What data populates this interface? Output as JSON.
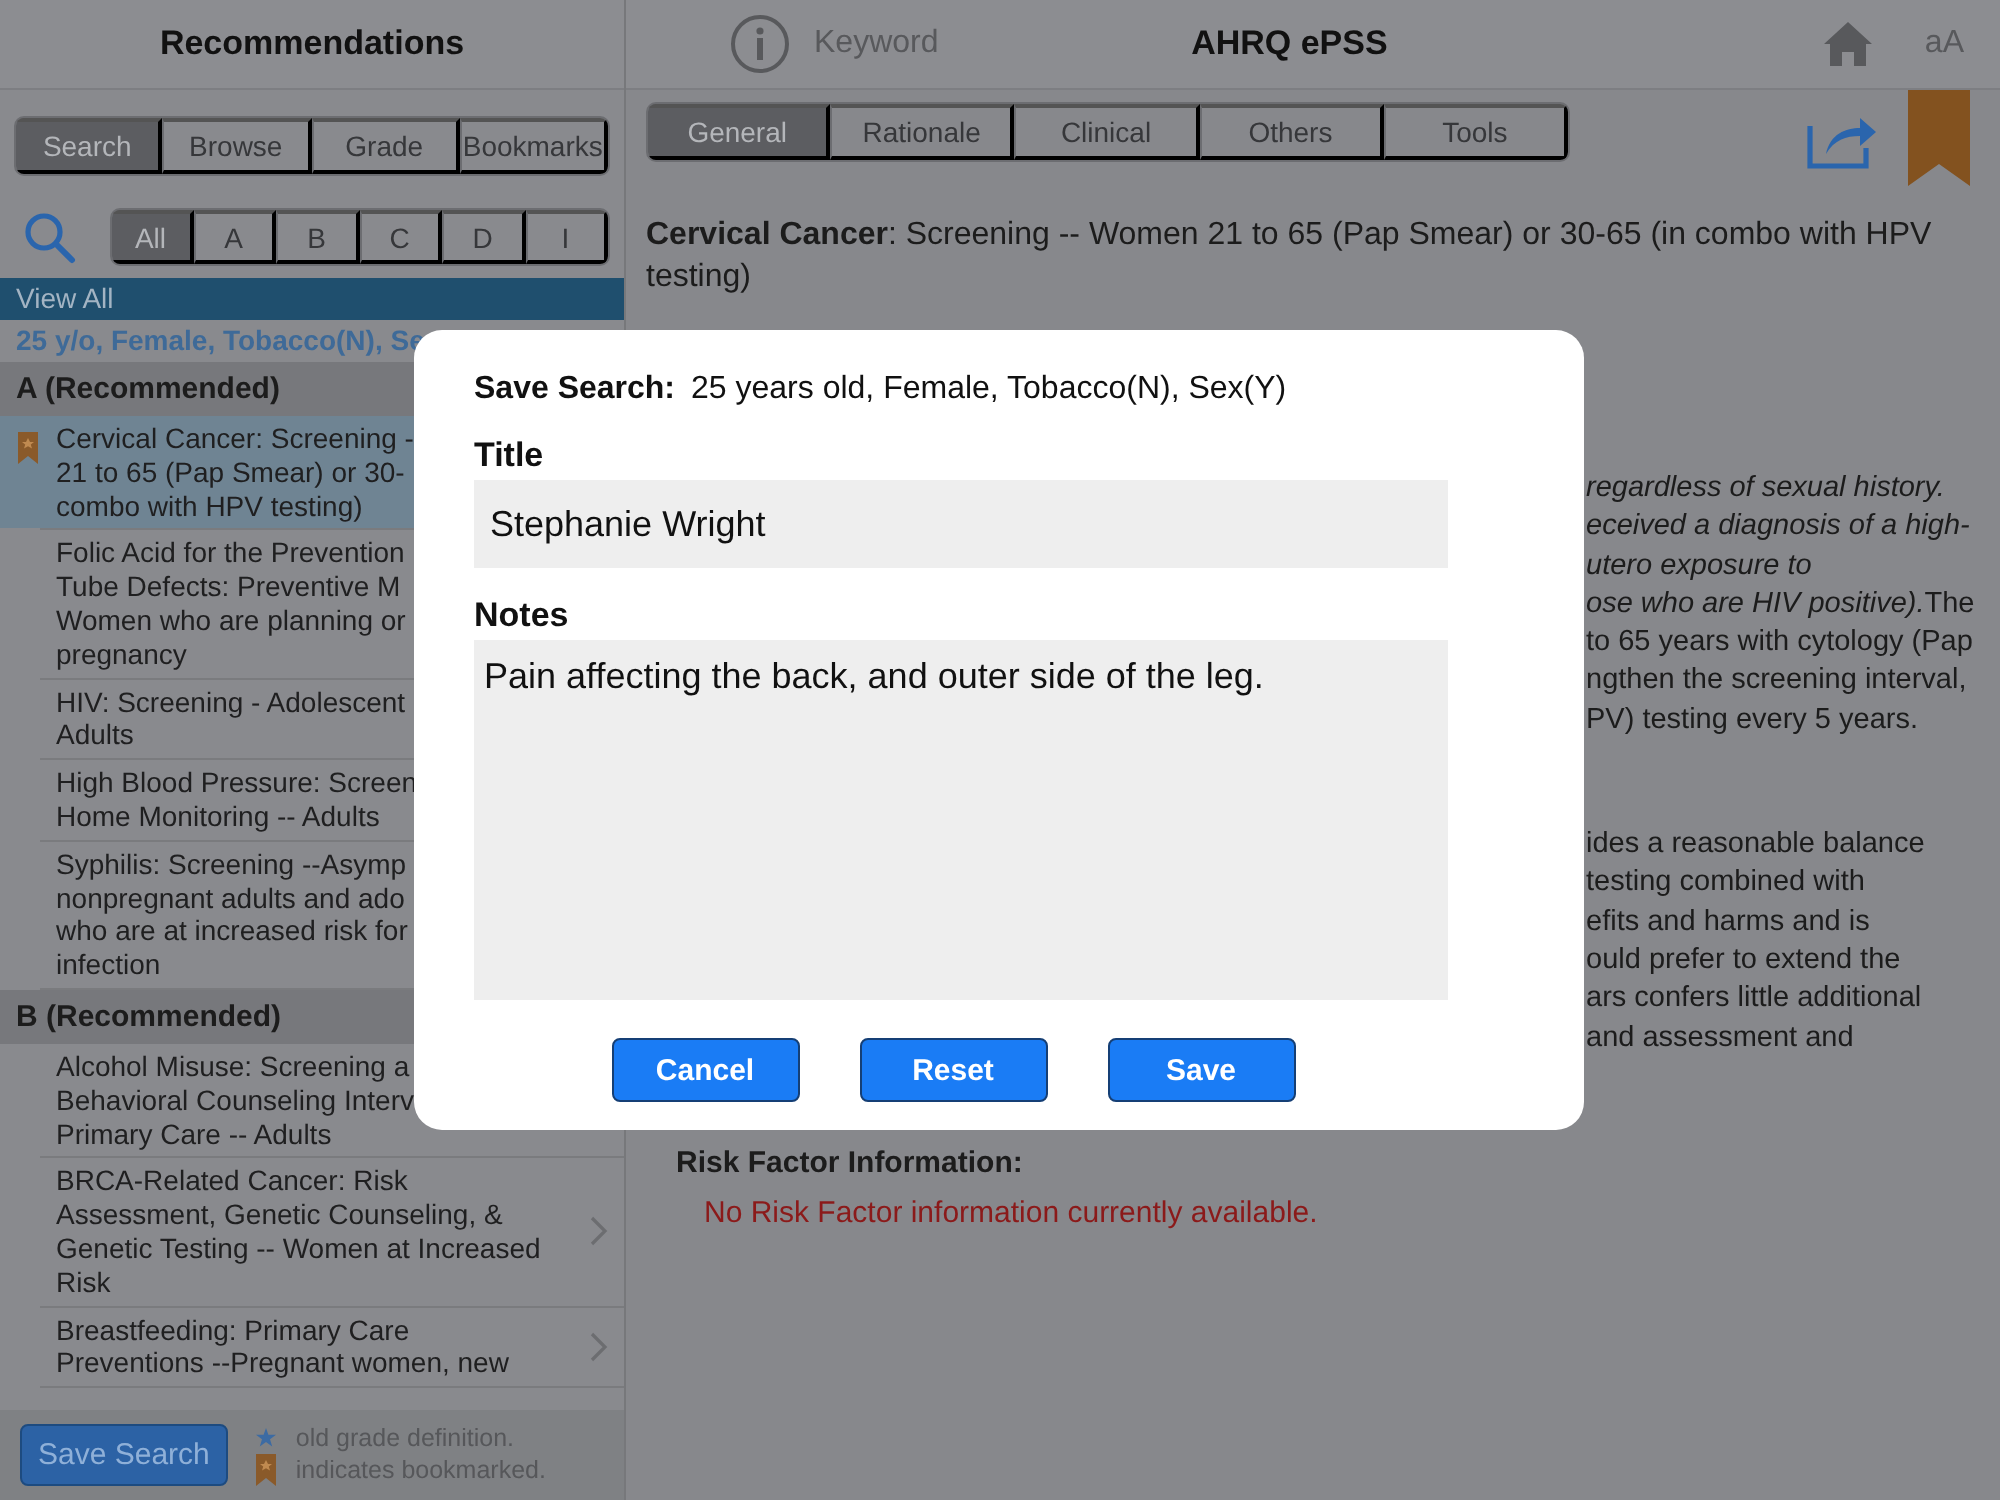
{
  "top_bar": {
    "left_title": "Recommendations",
    "keyword_placeholder": "Keyword",
    "title": "AHRQ ePSS",
    "text_size_label": "aA"
  },
  "sidebar": {
    "modes": [
      {
        "label": "Search",
        "selected": true
      },
      {
        "label": "Browse",
        "selected": false
      },
      {
        "label": "Grade",
        "selected": false
      },
      {
        "label": "Bookmarks",
        "selected": false
      }
    ],
    "grades": [
      {
        "label": "All",
        "selected": true
      },
      {
        "label": "A",
        "selected": false
      },
      {
        "label": "B",
        "selected": false
      },
      {
        "label": "C",
        "selected": false
      },
      {
        "label": "D",
        "selected": false
      },
      {
        "label": "I",
        "selected": false
      }
    ],
    "view_all": "View All",
    "filter": "25 y/o, Female, Tobacco(N), Se",
    "sections": [
      {
        "title": "A (Recommended)",
        "items": [
          {
            "lines": [
              "Cervical Cancer: Screening -",
              "21 to 65 (Pap Smear) or 30-",
              "combo with HPV testing)"
            ],
            "selected": true,
            "bookmarked": true,
            "chevron": false
          },
          {
            "lines": [
              "Folic Acid for the Prevention",
              "Tube Defects: Preventive M",
              "Women who are planning or",
              "pregnancy"
            ],
            "selected": false,
            "bookmarked": false,
            "chevron": false
          },
          {
            "lines": [
              "HIV: Screening - Adolescent",
              "Adults"
            ],
            "selected": false,
            "bookmarked": false,
            "chevron": false
          },
          {
            "lines": [
              "High Blood Pressure: Screen",
              "Home Monitoring -- Adults"
            ],
            "selected": false,
            "bookmarked": false,
            "chevron": false
          },
          {
            "lines": [
              "Syphilis: Screening --Asymp",
              "nonpregnant adults and ado",
              "who are at increased risk for",
              "infection"
            ],
            "selected": false,
            "bookmarked": false,
            "chevron": false
          }
        ]
      },
      {
        "title": "B (Recommended)",
        "items": [
          {
            "lines": [
              "Alcohol Misuse: Screening a",
              "Behavioral Counseling Interv",
              "Primary Care -- Adults"
            ],
            "selected": false,
            "bookmarked": false,
            "chevron": false
          },
          {
            "lines": [
              "BRCA-Related Cancer: Risk",
              "Assessment, Genetic Counseling, &",
              "Genetic Testing -- Women at Increased",
              "Risk"
            ],
            "selected": false,
            "bookmarked": false,
            "chevron": true
          },
          {
            "lines": [
              "Breastfeeding: Primary Care",
              "Preventions --Pregnant women, new"
            ],
            "selected": false,
            "bookmarked": false,
            "chevron": true
          }
        ]
      }
    ],
    "save_search_button": "Save Search",
    "legend": [
      {
        "kind": "star",
        "text": "old grade definition."
      },
      {
        "kind": "bookmark",
        "text": "indicates bookmarked."
      }
    ]
  },
  "detail": {
    "tabs": [
      {
        "label": "General",
        "selected": true
      },
      {
        "label": "Rationale",
        "selected": false
      },
      {
        "label": "Clinical",
        "selected": false
      },
      {
        "label": "Others",
        "selected": false
      },
      {
        "label": "Tools",
        "selected": false
      }
    ],
    "bookmarked": true,
    "heading": "**Cervical Cancer**: Screening -- Women 21 to 65 (Pap Smear) or 30-65 (in combo with HPV testing)",
    "fragment_groups": [
      [
        {
          "text": "regardless of sexual history.",
          "italic": true
        },
        {
          "text": "eceived a diagnosis of a high-",
          "italic": true
        },
        {
          "text": "utero exposure to",
          "italic": true
        },
        {
          "text": "ose who are HIV positive).",
          "italic": true,
          "tail": "The"
        },
        {
          "text": "to 65 years with cytology (Pap",
          "italic": false
        },
        {
          "text": "ngthen the screening interval,",
          "italic": false
        },
        {
          "text": "PV) testing every 5 years.",
          "italic": false
        }
      ],
      [
        {
          "text": "ides a reasonable balance",
          "italic": false
        },
        {
          "text": "testing combined with",
          "italic": false
        },
        {
          "text": "efits and harms and is",
          "italic": false
        },
        {
          "text": "ould prefer to extend the",
          "italic": false
        },
        {
          "text": "ars confers little additional",
          "italic": false
        },
        {
          "text": "and assessment and",
          "italic": false
        }
      ]
    ],
    "risk_title": "Risk Factor Information:",
    "risk_text": "No Risk Factor information currently available."
  },
  "dialog": {
    "label": "Save Search:",
    "summary": "25 years old, Female, Tobacco(N), Sex(Y)",
    "title_label": "Title",
    "title_value": "Stephanie Wright",
    "notes_label": "Notes",
    "notes_value": "Pain affecting the back, and outer side of the leg.",
    "buttons": [
      "Cancel",
      "Reset",
      "Save"
    ]
  }
}
